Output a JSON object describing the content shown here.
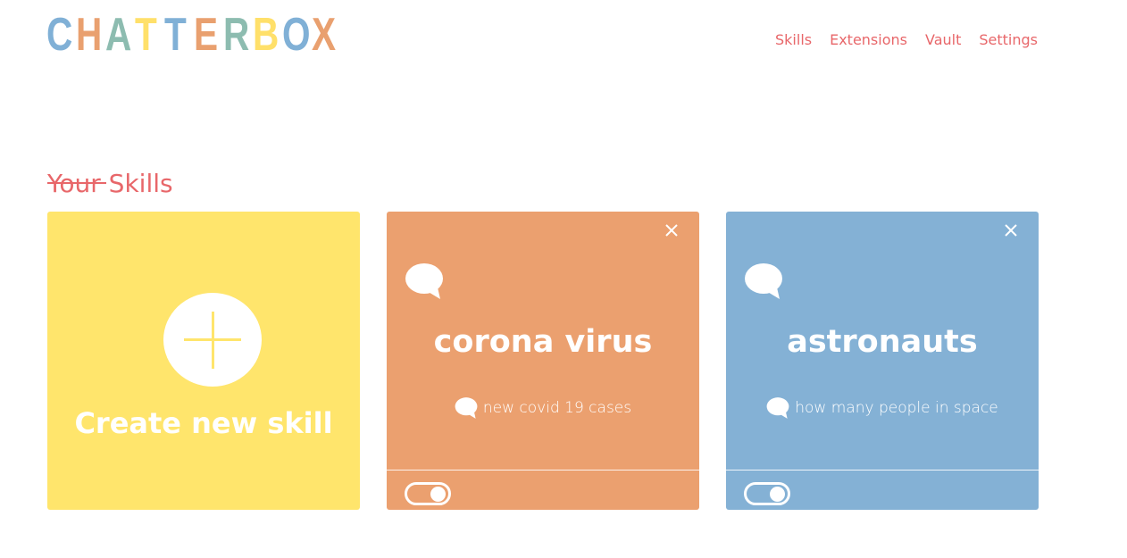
{
  "app": {
    "logo_text": "CHATTERBOX",
    "logo_letters": [
      {
        "char": "C",
        "color": "#80b0d6"
      },
      {
        "char": "H",
        "color": "#e9a06f"
      },
      {
        "char": "A",
        "color": "#8dbcb0"
      },
      {
        "char": "T",
        "color": "#ffe06a"
      },
      {
        "char": "T",
        "color": "#80b0d6"
      },
      {
        "char": "E",
        "color": "#e9a06f"
      },
      {
        "char": "R",
        "color": "#8dbcb0"
      },
      {
        "char": "B",
        "color": "#ffe06a"
      },
      {
        "char": "O",
        "color": "#80b0d6"
      },
      {
        "char": "X",
        "color": "#e9a06f"
      }
    ]
  },
  "nav": {
    "items": [
      "Skills",
      "Extensions",
      "Vault",
      "Settings"
    ]
  },
  "section": {
    "title": "Your Skills"
  },
  "create_card": {
    "label": "Create new skill"
  },
  "skills": [
    {
      "title": "corona virus",
      "phrase": "new covid 19 cases",
      "enabled": true,
      "color": "#eba06f"
    },
    {
      "title": "astronauts",
      "phrase": "how many people in space",
      "enabled": true,
      "color": "#84b1d5"
    }
  ],
  "colors": {
    "accent": "#e8676a",
    "create_card": "#ffe56c"
  }
}
